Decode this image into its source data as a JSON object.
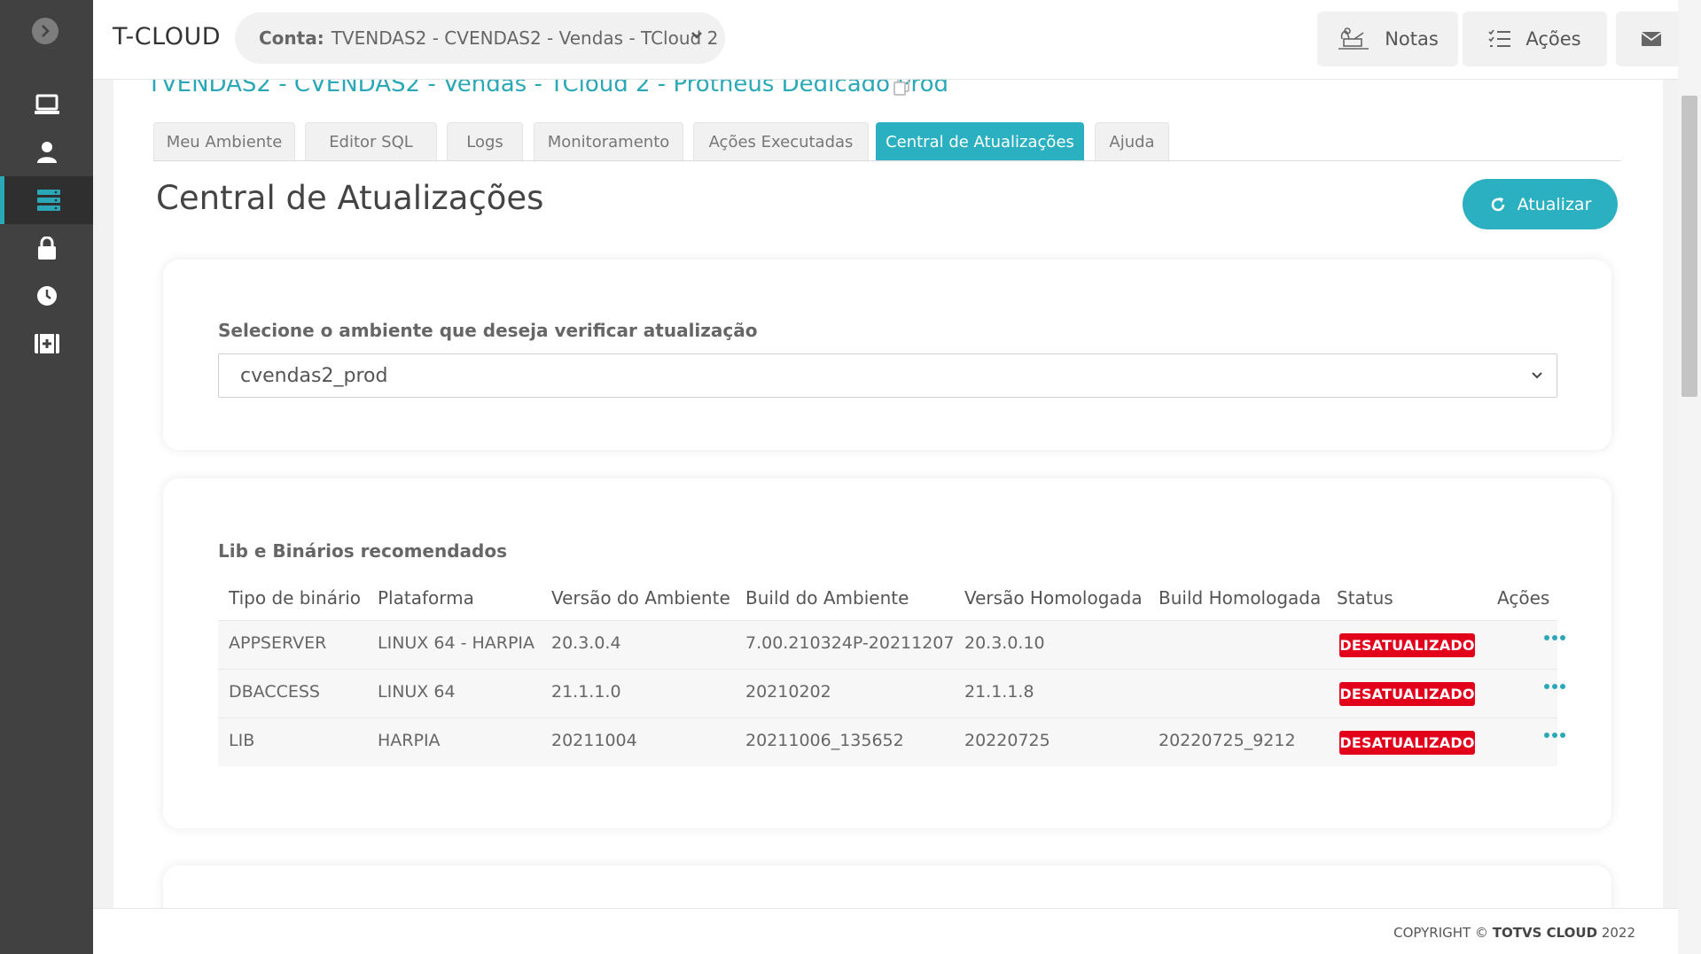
{
  "sidebar": {
    "items": [
      {
        "icon": "desktop-icon",
        "active": false
      },
      {
        "icon": "user-icon",
        "active": false
      },
      {
        "icon": "server-icon",
        "active": true
      },
      {
        "icon": "lock-icon",
        "active": false
      },
      {
        "icon": "clock-icon",
        "active": false
      },
      {
        "icon": "first-aid-kit-icon",
        "active": false
      }
    ]
  },
  "header": {
    "brand": "T-CLOUD",
    "account_label": "Conta:",
    "account_value": "TVENDAS2 - CVENDAS2 - Vendas - TCloud 2",
    "notes_label": "Notas",
    "actions_label": "Ações"
  },
  "environment_title": "TVENDAS2 - CVENDAS2 - Vendas - TCloud 2 - Protheus Dedicado Prod",
  "tabs": [
    {
      "label": "Meu Ambiente"
    },
    {
      "label": "Editor SQL"
    },
    {
      "label": "Logs"
    },
    {
      "label": "Monitoramento"
    },
    {
      "label": "Ações Executadas"
    },
    {
      "label": "Central de Atualizações"
    },
    {
      "label": "Ajuda"
    }
  ],
  "page_title": "Central de Atualizações",
  "refresh_label": "Atualizar",
  "env_select": {
    "label": "Selecione o ambiente que deseja verificar atualização",
    "value": "cvendas2_prod"
  },
  "binaries": {
    "title": "Lib e Binários recomendados",
    "columns": [
      "Tipo de binário",
      "Plataforma",
      "Versão do Ambiente",
      "Build do Ambiente",
      "Versão Homologada",
      "Build Homologada",
      "Status",
      "Ações"
    ],
    "rows": [
      {
        "tipo": "APPSERVER",
        "plataforma": "LINUX 64 - HARPIA",
        "versao_ambiente": "20.3.0.4",
        "build_ambiente": "7.00.210324P-20211207",
        "versao_homologada": "20.3.0.10",
        "build_homologada": "",
        "status": "DESATUALIZADO"
      },
      {
        "tipo": "DBACCESS",
        "plataforma": "LINUX 64",
        "versao_ambiente": "21.1.1.0",
        "build_ambiente": "20210202",
        "versao_homologada": "21.1.1.8",
        "build_homologada": "",
        "status": "DESATUALIZADO"
      },
      {
        "tipo": "LIB",
        "plataforma": "HARPIA",
        "versao_ambiente": "20211004",
        "build_ambiente": "20211006_135652",
        "versao_homologada": "20220725",
        "build_homologada": "20220725_9212",
        "status": "DESATUALIZADO"
      }
    ]
  },
  "footer": {
    "prefix": "COPYRIGHT ©",
    "brand": "TOTVS CLOUD",
    "year": "2022"
  },
  "colors": {
    "accent": "#2ab0c0",
    "sidebar": "#414141",
    "status_red": "#e3001b"
  }
}
